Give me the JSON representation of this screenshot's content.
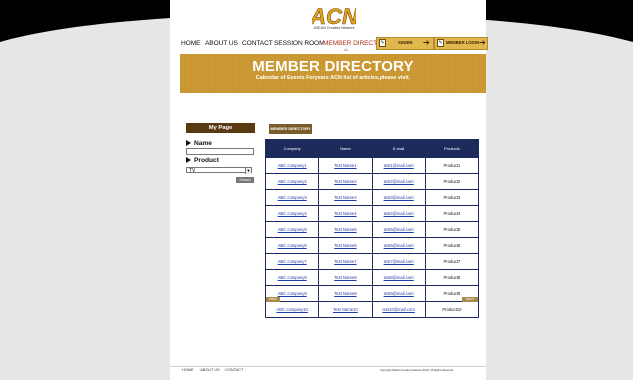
{
  "brand": {
    "logo_text": "ACN",
    "tagline": "ASEAN Creative Network"
  },
  "nav": {
    "items": [
      "HOME",
      "ABOUT US",
      "CONTACT",
      "SESSION ROOM",
      "MEMBER DIRECTORY"
    ],
    "active": "MEMBER DIRECTORY"
  },
  "auth": {
    "signin_label": "SIGNIN",
    "member_login_label": "MEMBER LOGIN"
  },
  "banner": {
    "title": "MEMBER DIRECTORY",
    "subtitle": "Calendar of Events Foryears ACN list of articles,please visit."
  },
  "sidebar": {
    "title": "My Page",
    "name_label": "Name",
    "name_value": "",
    "product_label": "Product",
    "product_selected": "TV",
    "search_label": "Search"
  },
  "directory": {
    "tab_label": "MEMBER DIRECTORY",
    "columns": [
      "Company",
      "Name",
      "E-mail",
      "Products"
    ],
    "rows": [
      [
        "ABC company1",
        "Test Name1",
        "test1@mail.com",
        "Product1"
      ],
      [
        "ABC company2",
        "Test Name2",
        "test2@mail.com",
        "Product2"
      ],
      [
        "ABC company3",
        "Test Name3",
        "test3@mail.com",
        "Product3"
      ],
      [
        "ABC company4",
        "Test Name4",
        "test4@mail.com",
        "Product4"
      ],
      [
        "ABC company5",
        "Test Name5",
        "test5@mail.com",
        "Product5"
      ],
      [
        "ABC company6",
        "Test Name6",
        "test6@mail.com",
        "Product6"
      ],
      [
        "ABC company7",
        "Test Name7",
        "test7@mail.com",
        "Product7"
      ],
      [
        "ABC company8",
        "Test Name8",
        "test8@mail.com",
        "Product8"
      ],
      [
        "ABC company9",
        "Test Name9",
        "test9@mail.com",
        "Product9"
      ],
      [
        "ABC company10",
        "Test Name10",
        "test10@mail.com",
        "Product10"
      ]
    ],
    "prev_label": "PREV",
    "next_label": "NEXT"
  },
  "footer": {
    "links": [
      "HOME",
      "ABOUT US",
      "CONTACT"
    ],
    "copyright": "Copyright ASEAN Creative Network (ACN). All Rights Reserved."
  },
  "colors": {
    "accent": "#c9962f",
    "table_header": "#1c2a5c",
    "active_nav": "#b0361e",
    "button_gold": "#e1b84d"
  }
}
